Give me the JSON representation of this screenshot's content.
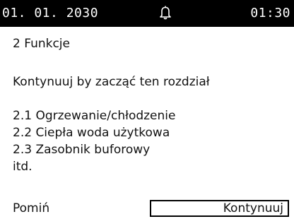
{
  "status_bar": {
    "date": "01. 01. 2030",
    "time": "01:30",
    "icon": "bell-icon"
  },
  "main": {
    "section_title": "2 Funkcje",
    "instruction": "Kontynuuj by zacząć ten rozdział",
    "items": [
      "2.1 Ogrzewanie/chłodzenie",
      "2.2 Ciepła woda użytkowa",
      "2.3 Zasobnik buforowy",
      "itd."
    ]
  },
  "footer": {
    "skip_label": "Pomiń",
    "continue_label": "Kontynuuj"
  }
}
